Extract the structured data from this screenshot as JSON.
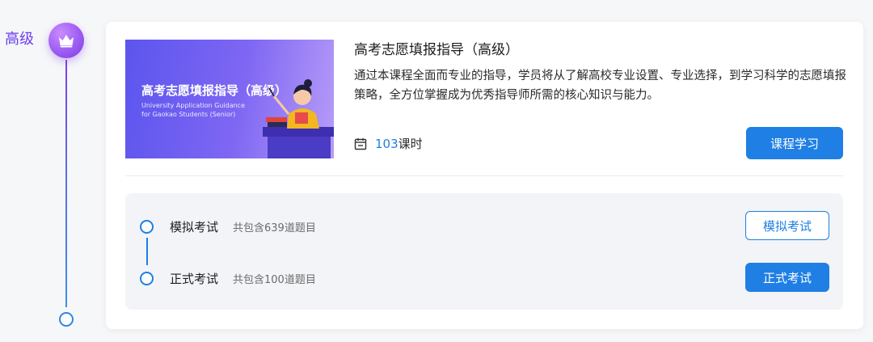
{
  "level": {
    "label": "高级",
    "badge_icon": "crown-icon",
    "accent": "#7b3fe6"
  },
  "course": {
    "cover": {
      "title": "高考志愿填报指导（高级）",
      "subtitle_line1": "University Application Guidance",
      "subtitle_line2": "for Gaokao Students (Senior)"
    },
    "title": "高考志愿填报指导（高级）",
    "description": "通过本课程全面而专业的指导，学员将从了解高校专业设置、专业选择，到学习科学的志愿填报策略，全方位掌握成为优秀指导师所需的核心知识与能力。",
    "hours_value": "103",
    "hours_unit": "课时",
    "study_button": "课程学习"
  },
  "exams": [
    {
      "name": "模拟考试",
      "count": "共包含639道题目",
      "button": "模拟考试"
    },
    {
      "name": "正式考试",
      "count": "共包含100道题目",
      "button": "正式考试"
    }
  ],
  "colors": {
    "primary": "#1f7fe4",
    "purple": "#7b3fe6"
  }
}
